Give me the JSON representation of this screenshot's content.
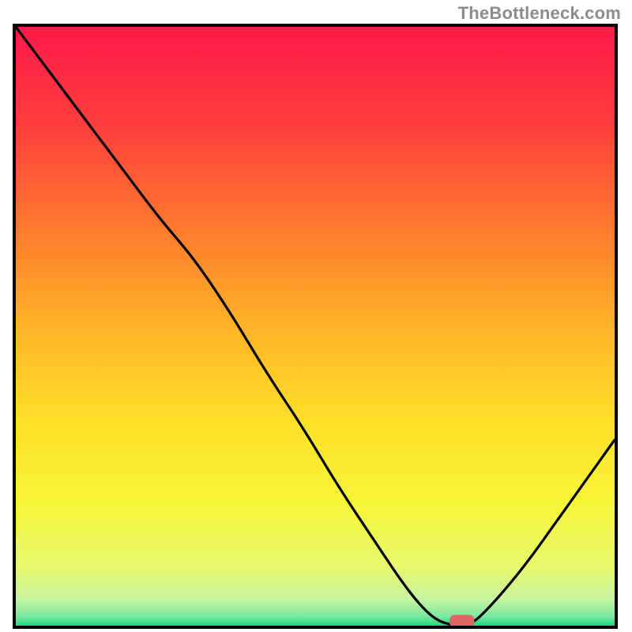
{
  "watermark": "TheBottleneck.com",
  "chart_data": {
    "type": "line",
    "title": "",
    "xlabel": "",
    "ylabel": "",
    "xlim": [
      0,
      100
    ],
    "ylim": [
      0,
      100
    ],
    "grid": false,
    "legend": false,
    "background_gradient": {
      "stops": [
        {
          "offset": 0.0,
          "color": "#ff1a49"
        },
        {
          "offset": 0.16,
          "color": "#ff3d3d"
        },
        {
          "offset": 0.34,
          "color": "#ff7a2e"
        },
        {
          "offset": 0.5,
          "color": "#ffb327"
        },
        {
          "offset": 0.66,
          "color": "#ffe028"
        },
        {
          "offset": 0.8,
          "color": "#f6f53a"
        },
        {
          "offset": 0.9,
          "color": "#e7f86b"
        },
        {
          "offset": 0.955,
          "color": "#c8f4a0"
        },
        {
          "offset": 0.985,
          "color": "#7be8a0"
        },
        {
          "offset": 1.0,
          "color": "#1fd67b"
        }
      ]
    },
    "series": [
      {
        "name": "bottleneck-curve",
        "x": [
          0,
          6,
          12,
          18,
          24,
          30,
          36,
          42,
          48,
          54,
          60,
          64,
          67,
          70,
          73,
          76,
          80,
          85,
          90,
          95,
          100
        ],
        "y": [
          100,
          92,
          84,
          76,
          68,
          61,
          52,
          42,
          33,
          23,
          14,
          8,
          4,
          1,
          0,
          0,
          4,
          10,
          17,
          24,
          31
        ]
      }
    ],
    "marker": {
      "x": 74.5,
      "y": 0,
      "width": 4,
      "height": 2,
      "color": "#e06666"
    }
  }
}
